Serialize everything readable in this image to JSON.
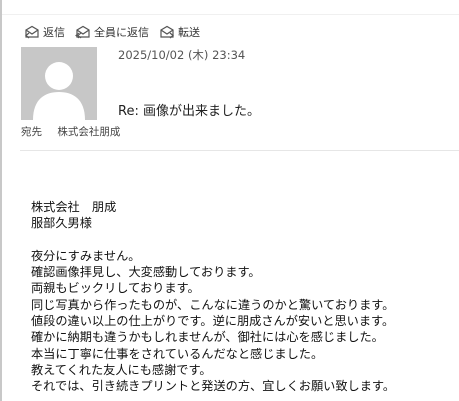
{
  "toolbar": {
    "reply_label": "返信",
    "reply_all_label": "全員に返信",
    "forward_label": "転送",
    "icon_color": "#555555"
  },
  "message": {
    "date": "2025/10/02 (木) 23:34",
    "subject": "Re: 画像が出来ました。",
    "to_label": "宛先",
    "to_value": "株式会社朋成"
  },
  "body": {
    "lines": [
      "株式会社　朋成",
      "服部久男様",
      "",
      "夜分にすみません。",
      "確認画像拝見し、大変感動しております。",
      "両親もビックリしております。",
      "同じ写真から作ったものが、こんなに違うのかと驚いております。",
      "値段の違い以上の仕上がりです。逆に朋成さんが安いと思います。",
      "確かに納期も違うかもしれませんが、御社には心を感じました。",
      "本当に丁寧に仕事をされているんだなと感じました。",
      "教えてくれた友人にも感謝です。",
      "それでは、引き続きプリントと発送の方、宜しくお願い致します。"
    ]
  },
  "colors": {
    "avatar_bg": "#c7c7c7",
    "avatar_fg": "#ffffff"
  }
}
